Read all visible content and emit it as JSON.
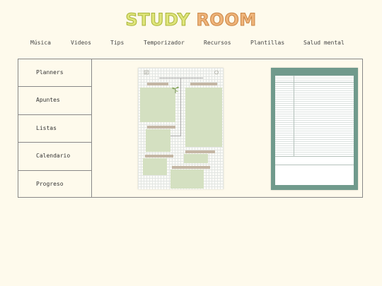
{
  "header": {
    "logo_word1": "STUDY",
    "logo_word2": "ROOM"
  },
  "nav": [
    "Música",
    "Videos",
    "Tips",
    "Temporizador",
    "Recursos",
    "Plantillas",
    "Salud mental"
  ],
  "sidebar": [
    "Planners",
    "Apuntes",
    "Listas",
    "Calendario",
    "Progreso"
  ],
  "colors": {
    "background": "#fefaec",
    "logo_study": "#dfe57a",
    "logo_room": "#efb47a",
    "template_green": "#709a8c",
    "template_sage": "#d4e0c1",
    "template_tag": "#c4b6a4"
  }
}
